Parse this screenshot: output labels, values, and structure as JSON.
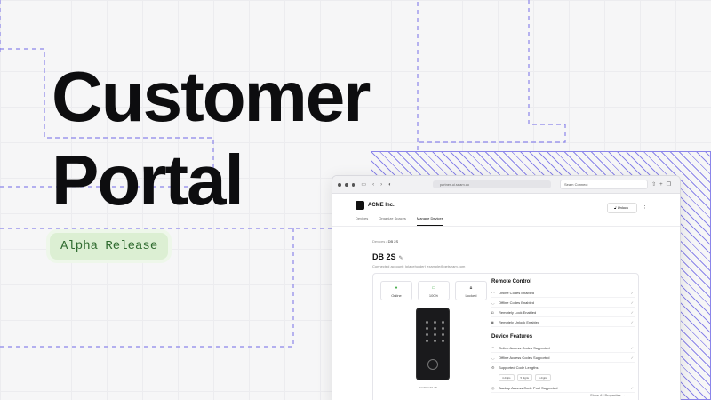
{
  "hero": {
    "title_line1": "Customer",
    "title_line2": "Portal",
    "badge": "Alpha Release"
  },
  "colors": {
    "accent_dash": "#8b85ea",
    "badge_bg": "#dcefd3",
    "badge_text": "#2f6b2f",
    "ok_green": "#4caf50"
  },
  "browser": {
    "url": "partner-ui.seam.co",
    "tab_label": "Seam Connect",
    "icons": [
      "sidebar-icon",
      "back-icon",
      "forward-icon",
      "shield-icon",
      "share-icon",
      "new-tab-icon",
      "tabs-icon"
    ]
  },
  "app": {
    "brand": "ACME Inc.",
    "nav": [
      "Devices",
      "Organize Spaces",
      "Manage Devices"
    ],
    "breadcrumb_root": "Devices",
    "breadcrumb_sep": "/",
    "breadcrumb_current": "DB 2S",
    "device_title": "DB 2S",
    "connected_account": "Connected account: (placeholder) example@getseam.com",
    "unlock_label": "Unlock",
    "status": [
      {
        "icon": "check-circle-icon",
        "label": "Online"
      },
      {
        "icon": "battery-icon",
        "label": "100%"
      },
      {
        "icon": "lock-icon",
        "label": "Locked"
      }
    ],
    "serial": "SG8D4A87-1B",
    "remote_control": {
      "title": "Remote Control",
      "items": [
        "Online Codes Enabled",
        "Offline Codes Enabled",
        "Remotely Lock Enabled",
        "Remotely Unlock Enabled"
      ]
    },
    "device_features": {
      "title": "Device Features",
      "items": [
        "Online Access Codes Supported",
        "Offline Access Codes Supported",
        "Supported Code Lengths",
        "Backup Access Code Pool Supported"
      ],
      "code_lengths": [
        "4 digits",
        "5 digits",
        "6 digits"
      ]
    },
    "show_all": "Show All Properties"
  }
}
